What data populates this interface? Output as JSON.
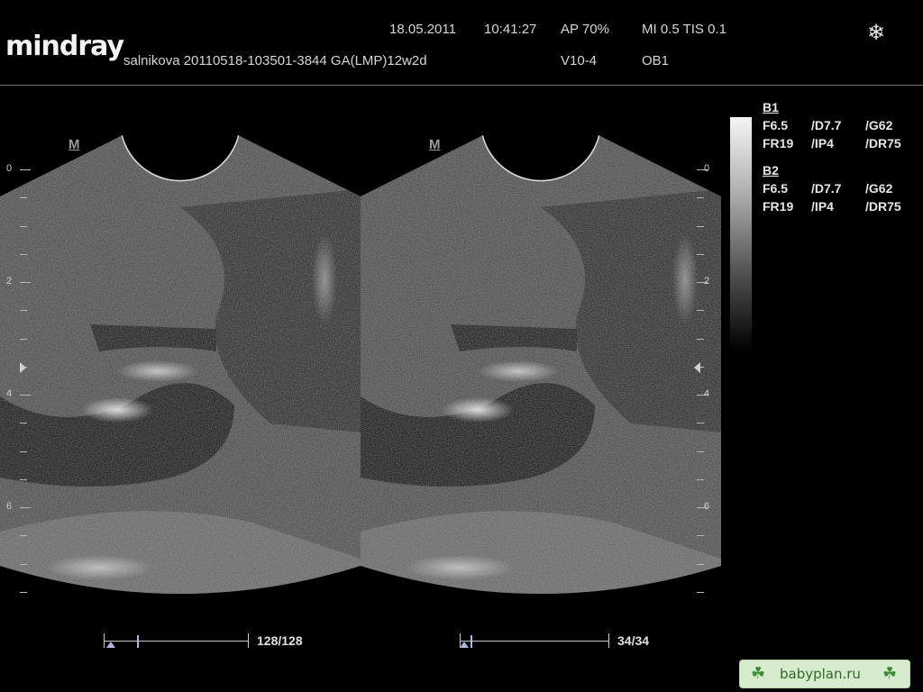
{
  "brand": "mindray",
  "header": {
    "date": "18.05.2011",
    "time": "10:41:27",
    "acoustic_power": "AP  70%",
    "mi_tis": "MI 0.5 TIS 0.1",
    "patient_info": "salnikova 20110518-103501-3844 GA(LMP)12w2d",
    "probe": "V10-4",
    "exam": "OB1",
    "freeze_icon": "snowflake-icon"
  },
  "panels": {
    "left": {
      "mark": "M",
      "cine_count": "128/128",
      "cine_position": 1.0
    },
    "right": {
      "mark": "M",
      "cine_count": "34/34",
      "cine_position": 1.0
    }
  },
  "depth_scale": {
    "labels": [
      "0",
      "2",
      "4",
      "6"
    ]
  },
  "params": {
    "b1": {
      "title": "B1",
      "row1": [
        "F6.5",
        "/D7.7",
        "/G62"
      ],
      "row2": [
        "FR19",
        "/IP4",
        "/DR75"
      ]
    },
    "b2": {
      "title": "B2",
      "row1": [
        "F6.5",
        "/D7.7",
        "/G62"
      ],
      "row2": [
        "FR19",
        "/IP4",
        "/DR75"
      ]
    }
  },
  "watermark": "babyplan.ru",
  "colors": {
    "background": "#000000",
    "text": "#d6d6d6",
    "cine_accent": "#aeb6e0",
    "watermark_bg": "#d7eccf"
  }
}
